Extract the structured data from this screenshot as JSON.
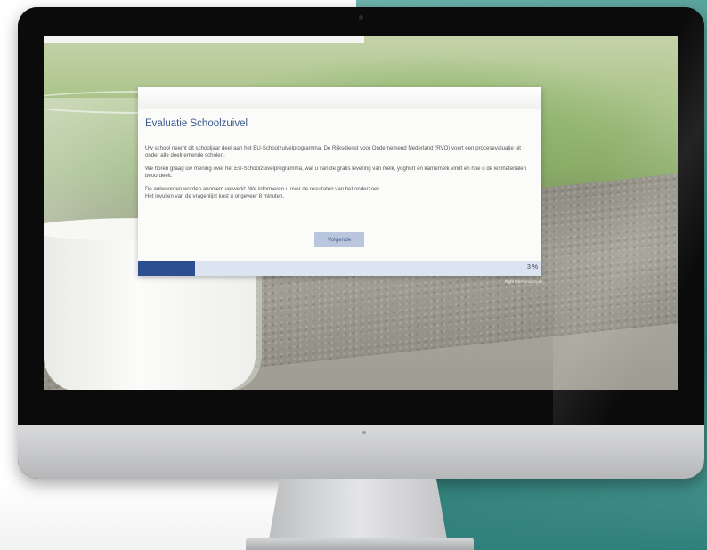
{
  "survey": {
    "title": "Evaluatie Schoolzuivel",
    "paragraphs": [
      "Uw school neemt dit schooljaar deel aan het EU-Schoolzuivelprogramma. De Rijksdienst voor Ondernemend Nederland (RVO) voert een procesevaluatie uit onder alle deelnemende scholen.",
      "We horen graag uw mening over het EU-Schoolzuivelprogramma, wat u van de gratis levering van melk, yoghurt en karnemelk vindt en hoe u de lesmaterialen beoordeelt.",
      "De antwoorden worden anoniem verwerkt. We informeren u over de resultaten van het onderzoek.",
      "Het invullen van de vragenlijst kost u ongeveer 8 minuten."
    ],
    "next_button": "Volgende",
    "progress": {
      "value": 0.03,
      "label": "3 %"
    },
    "footer_brand": "Right Marktonderzoek"
  },
  "colors": {
    "title": "#3b5a8f",
    "button_bg": "#b9c6de",
    "progress_fill": "#2e4f8f",
    "progress_track": "#dde4f1"
  }
}
